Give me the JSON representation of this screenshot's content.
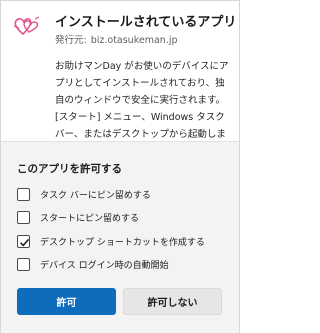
{
  "dialog": {
    "title": "インストールされているアプリ",
    "publisher_label": "発行元:",
    "publisher": "biz.otasukeman.jp",
    "description": "お助けマンDay がお使いのデバイスにアプリとしてインストールされており、独自のウィンドウで安全に実行されます。[スタート] メニュー、Windows タスク バー、またはデスクトップから起動します。",
    "app_icon": "heart-logo-icon"
  },
  "permissions": {
    "title": "このアプリを許可する",
    "options": [
      {
        "label": "タスク バーにピン留めする",
        "checked": false
      },
      {
        "label": "スタートにピン留めする",
        "checked": false
      },
      {
        "label": "デスクトップ ショートカットを作成する",
        "checked": true
      },
      {
        "label": "デバイス ログイン時の自動開始",
        "checked": false
      }
    ]
  },
  "buttons": {
    "allow": "許可",
    "deny": "許可しない"
  },
  "colors": {
    "accent": "#0f6cbd",
    "logo": "#e0518d"
  }
}
